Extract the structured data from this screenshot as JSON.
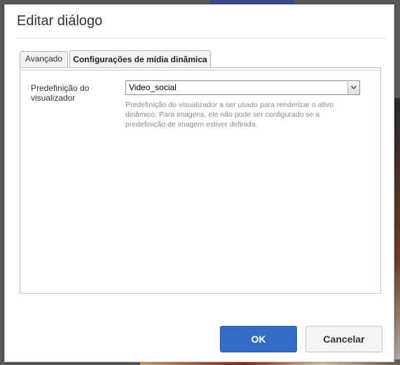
{
  "dialog": {
    "title": "Editar diálogo"
  },
  "tabs": [
    {
      "label": "Avançado",
      "active": false
    },
    {
      "label": "Configurações de mídia dinâmica",
      "active": true
    }
  ],
  "form": {
    "viewer_preset": {
      "label": "Predefinição do visualizador",
      "selected_value": "Video_social",
      "help": "Predefinição do visualizador a ser usado para renderizar o ativo dinâmico. Para imagens, ele não pode ser configurado se a predefinição de imagem estiver definida."
    }
  },
  "buttons": {
    "ok": "OK",
    "cancel": "Cancelar"
  },
  "colors": {
    "primary": "#326ec8",
    "help_text": "#8a8a8a"
  }
}
